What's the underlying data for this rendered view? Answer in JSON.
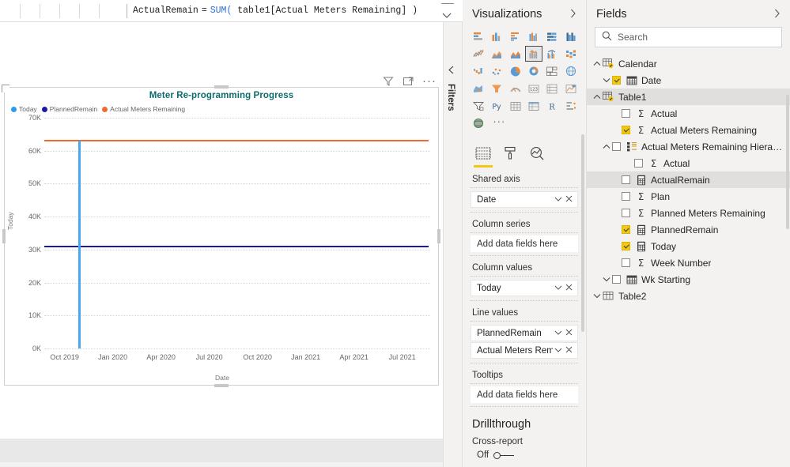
{
  "formula_bar": {
    "measure_name": "ActualRemain",
    "equals": "=",
    "function": "SUM(",
    "argument": " table1[Actual Meters Remaining] )",
    "expand_icon": "chevron-down-icon"
  },
  "visual_header": {
    "filter_icon": "filter-icon",
    "focus_icon": "focus-mode-icon",
    "more_icon": "more-options-ellipsis"
  },
  "filters_pane": {
    "label": "Filters",
    "expand_icon": "chevron-left-icon"
  },
  "chart_data": {
    "type": "line",
    "title": "Meter Re-programming Progress",
    "xlabel": "Date",
    "ylabel": "Today",
    "ylim": [
      0,
      70000
    ],
    "yticks": [
      "0K",
      "10K",
      "20K",
      "30K",
      "40K",
      "50K",
      "60K",
      "70K"
    ],
    "ytick_values": [
      0,
      10000,
      20000,
      30000,
      40000,
      50000,
      60000,
      70000
    ],
    "xticks": [
      "Oct 2019",
      "Jan 2020",
      "Apr 2020",
      "Jul 2020",
      "Oct 2020",
      "Jan 2021",
      "Apr 2021",
      "Jul 2021"
    ],
    "grid": true,
    "legend_position": "top-left",
    "legend": [
      {
        "name": "Today",
        "color": "#2b9ced"
      },
      {
        "name": "PlannedRemain",
        "color": "#1a1aa6"
      },
      {
        "name": "Actual Meters Remaining",
        "color": "#ee6b33"
      }
    ],
    "series": [
      {
        "name": "Actual Meters Remaining",
        "type": "line",
        "color": "#ee6b33",
        "constant_value": 63000
      },
      {
        "name": "PlannedRemain",
        "type": "line",
        "color": "#1a1aa6",
        "constant_value": 31000
      },
      {
        "name": "Today",
        "type": "column",
        "color": "#4aa7ef",
        "at_x": "Nov 2019",
        "value": 63000
      }
    ]
  },
  "visualizations": {
    "title": "Visualizations",
    "chevron": "chevron-right-icon",
    "gallery": [
      "stacked-bar-chart",
      "stacked-column-chart",
      "clustered-bar-chart",
      "clustered-column-chart",
      "100-percent-stacked-bar-chart",
      "100-percent-stacked-column-chart",
      "line-chart",
      "area-chart",
      "stacked-area-chart",
      "line-and-stacked-column-chart",
      "line-and-clustered-column-chart",
      "ribbon-chart",
      "waterfall-chart",
      "scatter-chart",
      "pie-chart",
      "donut-chart",
      "treemap",
      "map",
      "filled-map",
      "funnel-chart",
      "gauge-chart",
      "card",
      "multi-row-card",
      "kpi",
      "slicer",
      "python-visual",
      "table",
      "matrix",
      "r-script-visual",
      "decomposition-tree",
      "arcgis-map"
    ],
    "selected_index": 9,
    "more_label": "···",
    "tabs": [
      {
        "name": "fields-tab",
        "icon": "fields-grid-icon",
        "active": true
      },
      {
        "name": "format-tab",
        "icon": "paint-roller-icon",
        "active": false
      },
      {
        "name": "analytics-tab",
        "icon": "magnifier-chart-icon",
        "active": false
      }
    ],
    "wells": [
      {
        "label": "Shared axis",
        "chips": [
          "Date"
        ],
        "placeholder": null
      },
      {
        "label": "Column series",
        "chips": [],
        "placeholder": "Add data fields here"
      },
      {
        "label": "Column values",
        "chips": [
          "Today"
        ],
        "placeholder": null
      },
      {
        "label": "Line values",
        "chips": [
          "PlannedRemain",
          "Actual Meters Remainin"
        ],
        "placeholder": null
      },
      {
        "label": "Tooltips",
        "chips": [],
        "placeholder": "Add data fields here"
      }
    ],
    "chip_dropdown_icon": "chevron-down-icon",
    "chip_remove_icon": "close-x-icon",
    "drillthrough": {
      "heading": "Drillthrough",
      "cross_report_label": "Cross-report",
      "toggle_state": "Off"
    }
  },
  "fields": {
    "title": "Fields",
    "chevron": "chevron-right-icon",
    "search_placeholder": "Search",
    "search_icon": "search-icon",
    "tree": [
      {
        "label": "Calendar",
        "level": 0,
        "chevron": "up",
        "icon": "table-icon-badge",
        "checkbox": null,
        "selected": false
      },
      {
        "label": "Date",
        "level": 1,
        "chevron": "down",
        "icon": "calendar-icon",
        "checkbox": true,
        "selected": false
      },
      {
        "label": "Table1",
        "level": 0,
        "chevron": "up",
        "icon": "table-icon-badge",
        "checkbox": null,
        "selected": true
      },
      {
        "label": "Actual",
        "level": 2,
        "chevron": null,
        "icon": "sigma-icon",
        "checkbox": false,
        "selected": false
      },
      {
        "label": "Actual Meters Remaining",
        "level": 2,
        "chevron": null,
        "icon": "sigma-icon",
        "checkbox": true,
        "selected": false
      },
      {
        "label": "Actual Meters Remaining Hierarchy",
        "level": 1,
        "chevron": "up",
        "icon": "hierarchy-icon",
        "checkbox": false,
        "selected": false
      },
      {
        "label": "Actual",
        "level": 3,
        "chevron": null,
        "icon": "sigma-icon",
        "checkbox": false,
        "selected": false
      },
      {
        "label": "ActualRemain",
        "level": 2,
        "chevron": null,
        "icon": "measure-calculator-icon",
        "checkbox": false,
        "selected": true
      },
      {
        "label": "Plan",
        "level": 2,
        "chevron": null,
        "icon": "sigma-icon",
        "checkbox": false,
        "selected": false
      },
      {
        "label": "Planned Meters Remaining",
        "level": 2,
        "chevron": null,
        "icon": "sigma-icon",
        "checkbox": false,
        "selected": false
      },
      {
        "label": "PlannedRemain",
        "level": 2,
        "chevron": null,
        "icon": "measure-calculator-icon",
        "checkbox": true,
        "selected": false
      },
      {
        "label": "Today",
        "level": 2,
        "chevron": null,
        "icon": "measure-calculator-icon",
        "checkbox": true,
        "selected": false
      },
      {
        "label": "Week Number",
        "level": 2,
        "chevron": null,
        "icon": "sigma-icon",
        "checkbox": false,
        "selected": false
      },
      {
        "label": "Wk Starting",
        "level": 1,
        "chevron": "down",
        "icon": "calendar-icon",
        "checkbox": false,
        "selected": false
      },
      {
        "label": "Table2",
        "level": 0,
        "chevron": "down",
        "icon": "table-icon",
        "checkbox": null,
        "selected": false
      }
    ]
  }
}
